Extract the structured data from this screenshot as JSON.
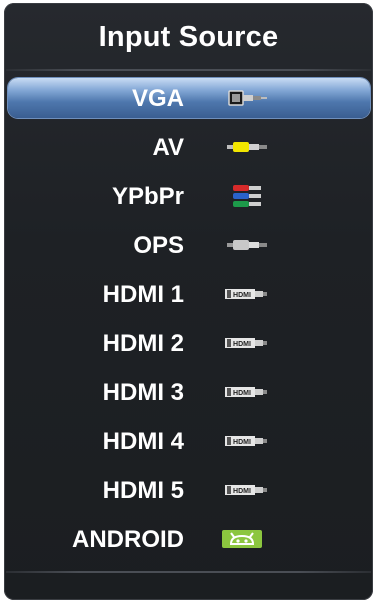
{
  "menu": {
    "title": "Input Source",
    "selected_index": 0,
    "items": [
      {
        "label": "VGA",
        "icon": "vga-connector-icon"
      },
      {
        "label": "AV",
        "icon": "av-rca-connector-icon"
      },
      {
        "label": "YPbPr",
        "icon": "ypbpr-component-connector-icon"
      },
      {
        "label": "OPS",
        "icon": "ops-connector-icon"
      },
      {
        "label": "HDMI 1",
        "icon": "hdmi-connector-icon",
        "icon_text": "HDMI"
      },
      {
        "label": "HDMI 2",
        "icon": "hdmi-connector-icon",
        "icon_text": "HDMI"
      },
      {
        "label": "HDMI 3",
        "icon": "hdmi-connector-icon",
        "icon_text": "HDMI"
      },
      {
        "label": "HDMI 4",
        "icon": "hdmi-connector-icon",
        "icon_text": "HDMI"
      },
      {
        "label": "HDMI 5",
        "icon": "hdmi-connector-icon",
        "icon_text": "HDMI"
      },
      {
        "label": "ANDROID",
        "icon": "android-icon"
      }
    ]
  },
  "colors": {
    "panel_background": "#1e2125",
    "highlight": "#5a83b8",
    "text": "#ffffff",
    "android_green": "#8cc63f",
    "av_yellow": "#f2e600",
    "ypbpr_green": "#1d9a4a",
    "ypbpr_blue": "#2a62c9",
    "ypbpr_red": "#d62a2a"
  }
}
